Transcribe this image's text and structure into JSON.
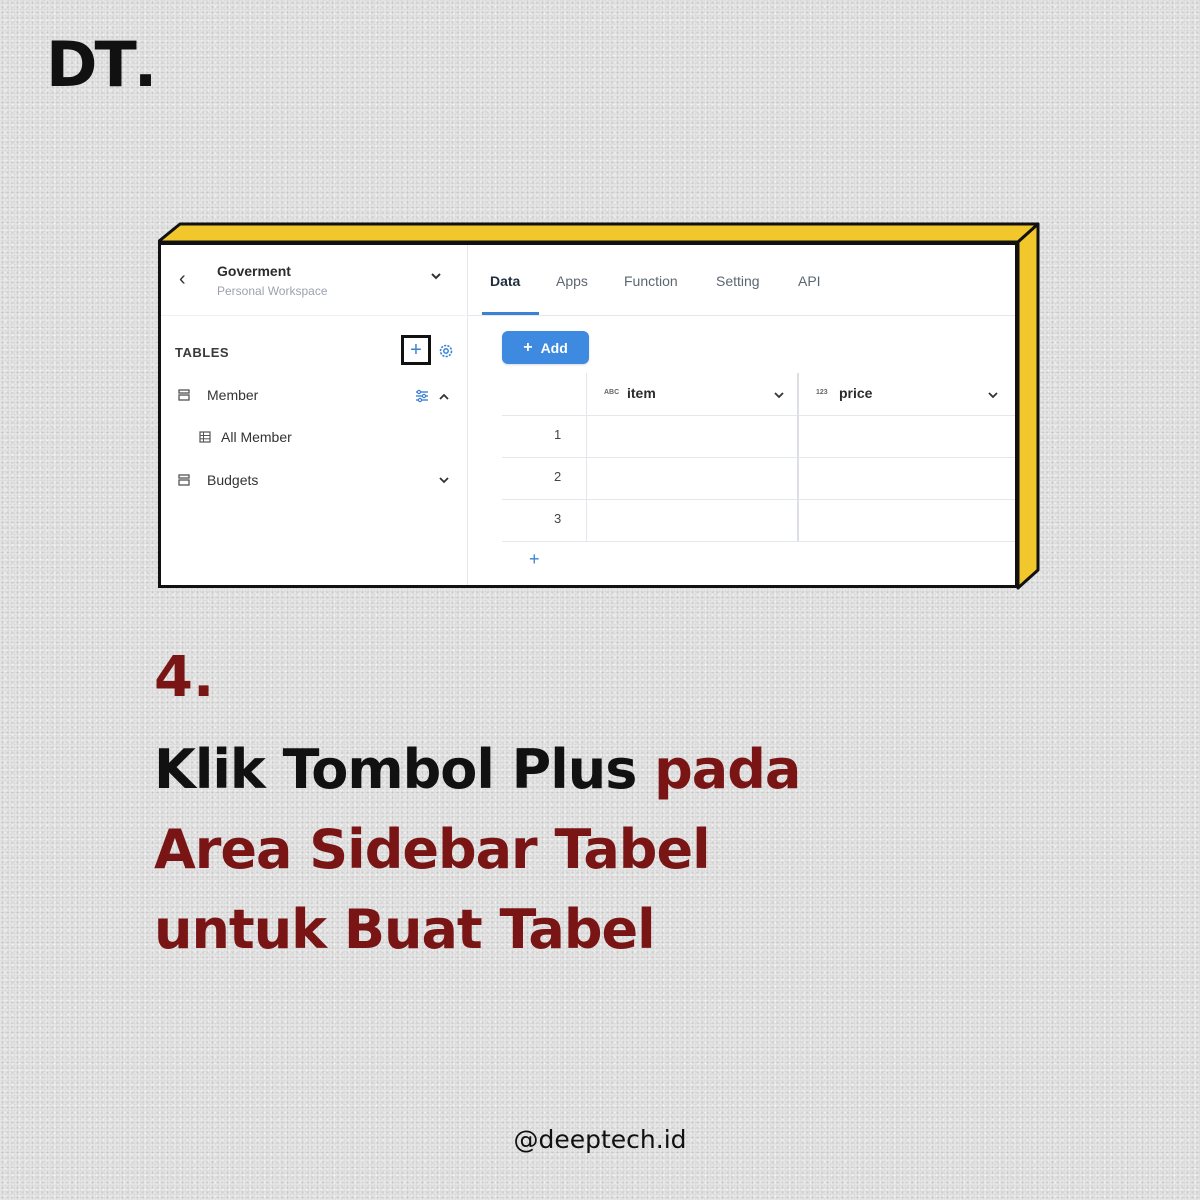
{
  "brand": {
    "logo_text": "DT",
    "logo_dot": "."
  },
  "screenshot": {
    "workspace": {
      "title": "Goverment",
      "subtitle": "Personal Workspace"
    },
    "sidebar": {
      "section_label": "TABLES",
      "items": [
        {
          "label": "Member",
          "expanded": true
        },
        {
          "label": "All Member"
        },
        {
          "label": "Budgets",
          "expanded": false
        }
      ]
    },
    "tabs": [
      {
        "label": "Data",
        "active": true
      },
      {
        "label": "Apps"
      },
      {
        "label": "Function"
      },
      {
        "label": "Setting"
      },
      {
        "label": "API"
      }
    ],
    "add_button": {
      "label": "Add"
    },
    "table": {
      "columns": [
        {
          "type_tag": "ABC",
          "name": "item"
        },
        {
          "type_tag": "123",
          "name": "price"
        }
      ],
      "rows": [
        "1",
        "2",
        "3"
      ]
    },
    "colors": {
      "accent": "#3d8ae0",
      "frame": "#f2c72c"
    }
  },
  "step": {
    "number": "4.",
    "line1_black": "Klik Tombol Plus",
    "line1_red": "pada",
    "line2": "Area Sidebar Tabel",
    "line3": "untuk Buat Tabel"
  },
  "footer": {
    "handle": "@deeptech.id"
  },
  "colors": {
    "headline_red": "#7a1515",
    "background": "#e6e6e6"
  }
}
